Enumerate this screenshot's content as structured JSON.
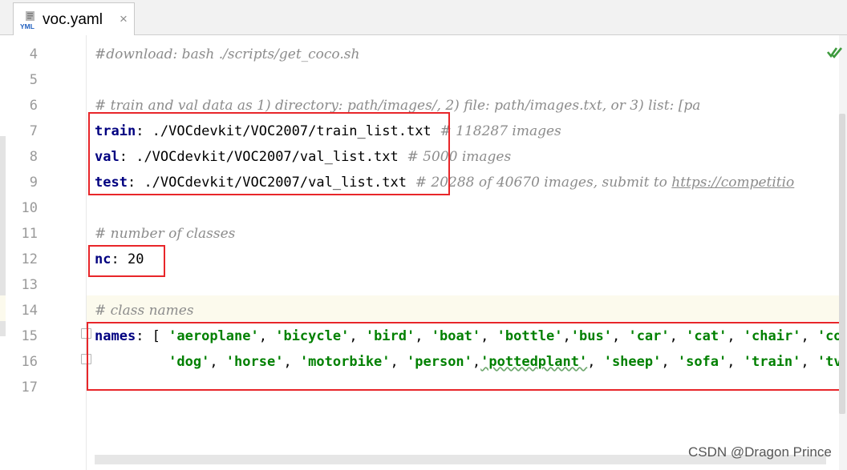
{
  "tab": {
    "title": "voc.yaml",
    "icon": "yaml-file-icon",
    "icon_text": "YML",
    "close": "×"
  },
  "line_numbers": [
    "4",
    "5",
    "6",
    "7",
    "8",
    "9",
    "10",
    "11",
    "12",
    "13",
    "14",
    "15",
    "16",
    "17"
  ],
  "lines": {
    "l4": {
      "comment": "#download: bash ./scripts/get_coco.sh"
    },
    "l6": {
      "comment": "# train and val data as 1) directory: path/images/, 2) file: path/images.txt, or 3) list: [pa"
    },
    "l7": {
      "key": "train",
      "sep": ": ",
      "value": "./VOCdevkit/VOC2007/train_list.txt",
      "comment": "  # 118287 images"
    },
    "l8": {
      "key": "val",
      "sep": ": ",
      "value": "./VOCdevkit/VOC2007/val_list.txt",
      "comment": "  # 5000 images"
    },
    "l9": {
      "key": "test",
      "sep": ": ",
      "value": "./VOCdevkit/VOC2007/val_list.txt",
      "comment": "  # 20288 of 40670 images, submit to ",
      "link": "https://competitio"
    },
    "l11": {
      "comment": "# number of classes"
    },
    "l12": {
      "key": "nc",
      "sep": ": ",
      "value": "20"
    },
    "l14": {
      "comment": "# class names"
    },
    "l15": {
      "key": "names",
      "sep": ": [ ",
      "items": [
        "'aeroplane'",
        "'bicycle'",
        "'bird'",
        "'boat'",
        "'bottle'",
        "'bus'",
        "'car'",
        "'cat'",
        "'chair'",
        "'cow"
      ]
    },
    "l16": {
      "indent": "         ",
      "items": [
        "'dog'",
        "'horse'",
        "'motorbike'",
        "'person'",
        "'pottedplant'",
        "'sheep'",
        "'sofa'",
        "'train'",
        "'tvm"
      ]
    }
  },
  "status": {
    "inspection_icon": "double-check-icon"
  },
  "watermark": "CSDN @Dragon Prince",
  "colors": {
    "annotation_box": "#e8262a",
    "yaml_key": "#000080",
    "string": "#008000",
    "comment": "#8c8c8c",
    "current_line": "#fcfaed",
    "check_icon": "#3d9a3d"
  }
}
